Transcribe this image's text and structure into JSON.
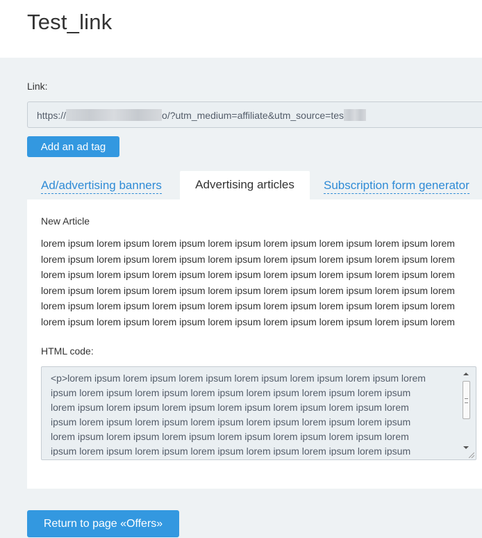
{
  "header": {
    "title": "Test_link"
  },
  "link": {
    "label": "Link:",
    "value_prefix": "https://",
    "value_middle": "o/?utm_medium=affiliate&utm_source=tes"
  },
  "buttons": {
    "add_ad_tag": "Add an ad tag",
    "return": "Return to page «Offers»"
  },
  "tabs": [
    {
      "label": "Ad/advertising banners",
      "active": false
    },
    {
      "label": "Advertising articles",
      "active": true
    },
    {
      "label": "Subscription form generator",
      "active": false
    }
  ],
  "article": {
    "title": "New Article",
    "lines": [
      "lorem ipsum lorem ipsum lorem ipsum lorem ipsum lorem ipsum lorem ipsum lorem ipsum lorem",
      "lorem ipsum lorem ipsum lorem ipsum lorem ipsum lorem ipsum lorem ipsum lorem ipsum lorem",
      "lorem ipsum lorem ipsum lorem ipsum lorem ipsum lorem ipsum lorem ipsum lorem ipsum lorem",
      "lorem ipsum lorem ipsum lorem ipsum lorem ipsum lorem ipsum lorem ipsum lorem ipsum lorem",
      "lorem ipsum lorem ipsum lorem ipsum lorem ipsum lorem ipsum lorem ipsum lorem ipsum lorem",
      "lorem ipsum lorem ipsum lorem ipsum lorem ipsum lorem ipsum lorem ipsum lorem ipsum lorem"
    ]
  },
  "html_code": {
    "label": "HTML code:",
    "lines": [
      "<p>lorem ipsum lorem ipsum lorem ipsum lorem ipsum lorem ipsum lorem ipsum lorem",
      "ipsum lorem ipsum lorem ipsum lorem ipsum lorem ipsum lorem ipsum lorem ipsum",
      "lorem ipsum lorem ipsum lorem ipsum lorem ipsum lorem ipsum lorem ipsum lorem",
      "ipsum lorem ipsum lorem ipsum lorem ipsum lorem ipsum lorem ipsum lorem ipsum",
      "lorem ipsum lorem ipsum lorem ipsum lorem ipsum lorem ipsum lorem ipsum lorem",
      "ipsum lorem ipsum lorem ipsum lorem ipsum lorem ipsum lorem ipsum lorem ipsum"
    ]
  },
  "colors": {
    "accent": "#3398e0",
    "link": "#2f8bd6",
    "background": "#eef2f4"
  }
}
